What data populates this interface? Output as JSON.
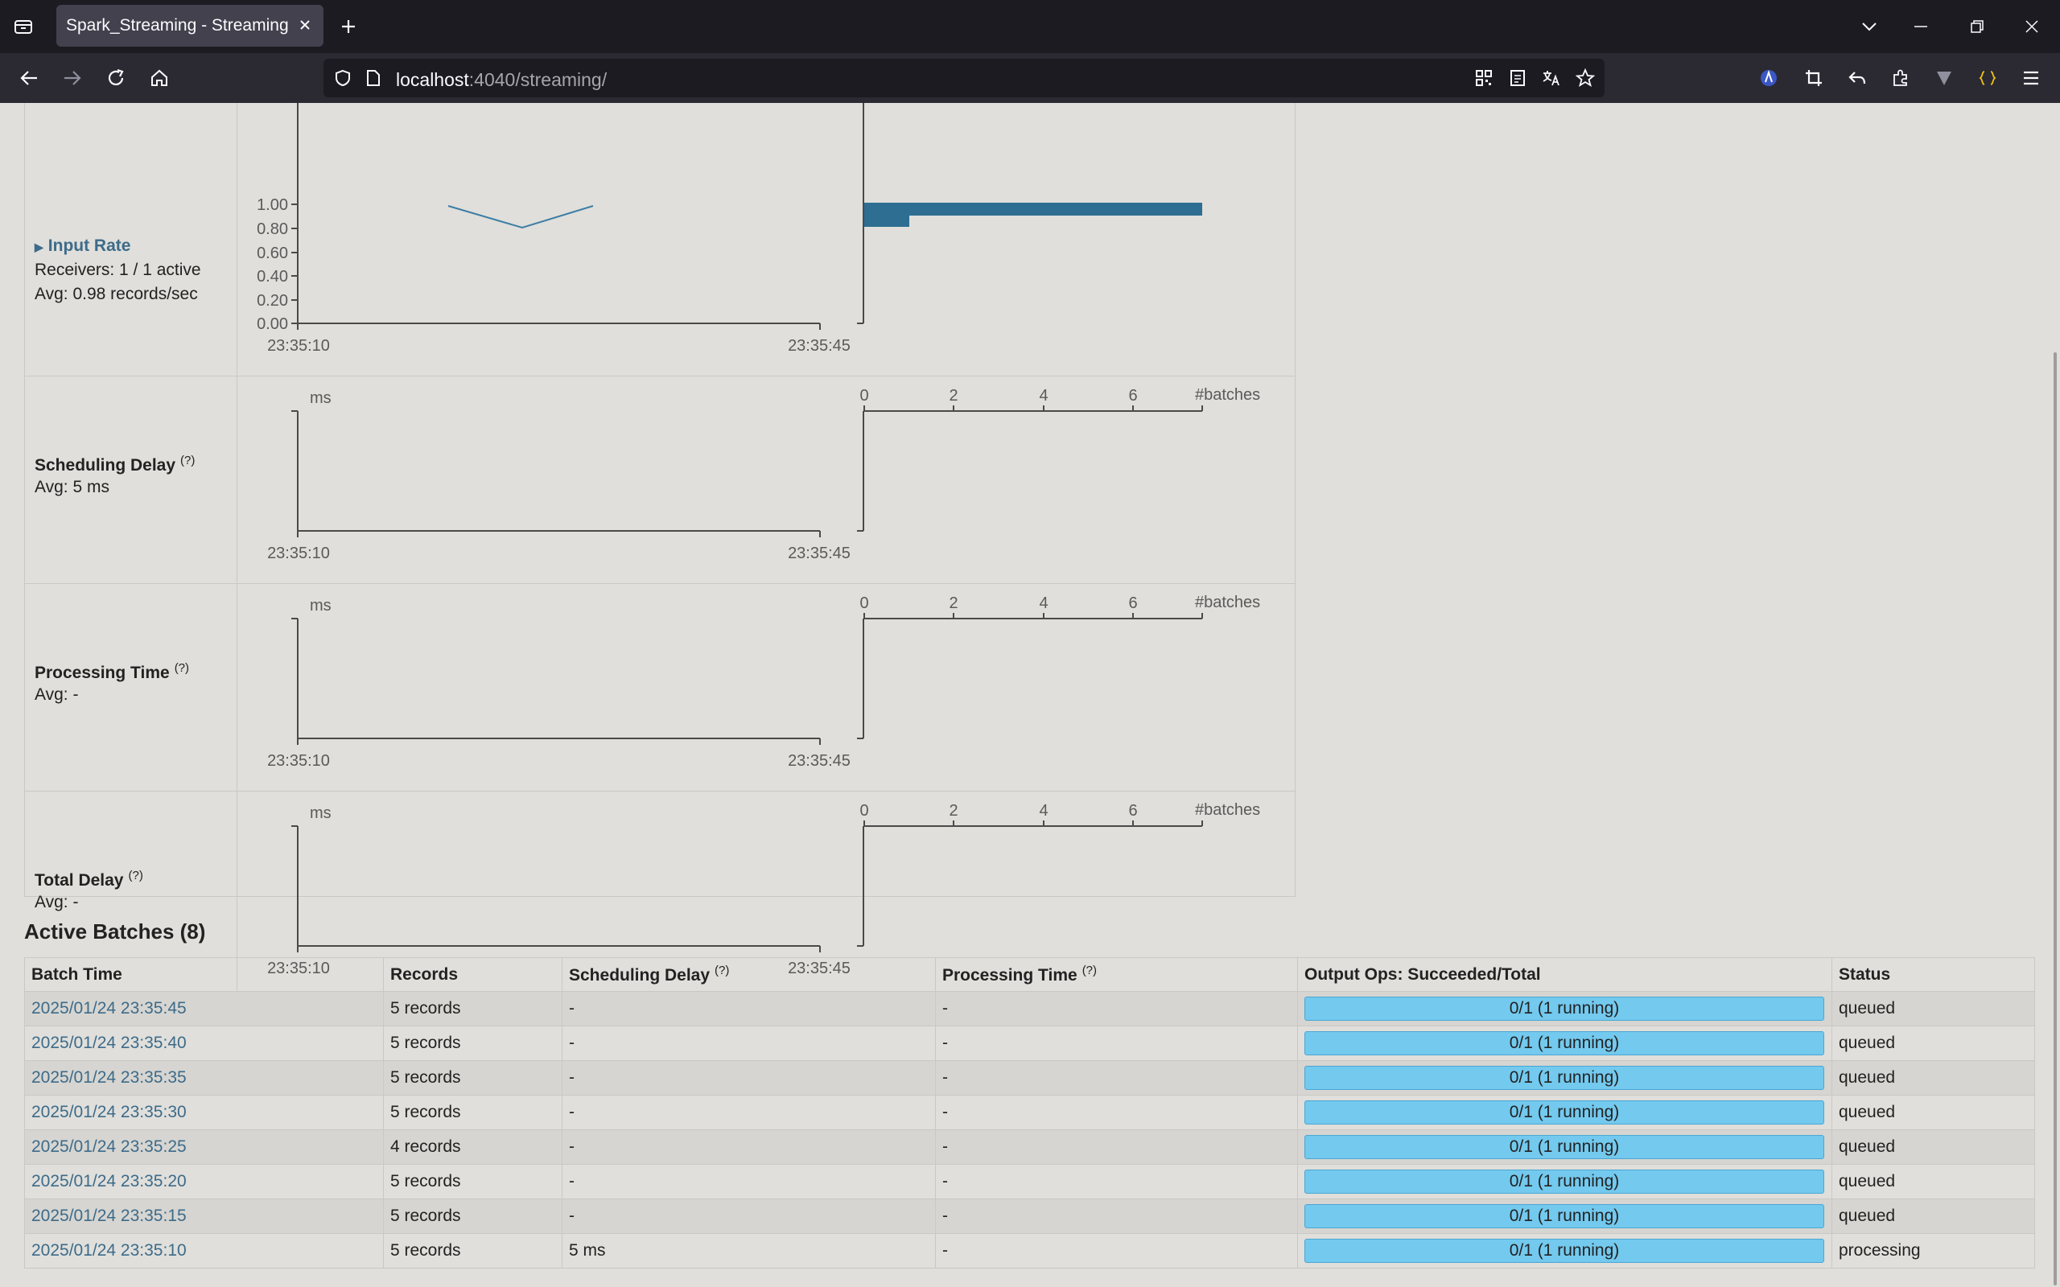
{
  "browser": {
    "tab_title": "Spark_Streaming - Streaming Statistics",
    "url_host": "localhost",
    "url_rest": ":4040/streaming/"
  },
  "charts": {
    "x_ticks": [
      "23:35:10",
      "23:35:45"
    ],
    "batches_ticks": [
      "0",
      "2",
      "4",
      "6"
    ],
    "unit_ms": "ms",
    "unit_batches": "#batches",
    "input_rate_yticks": [
      "1.00",
      "0.80",
      "0.60",
      "0.40",
      "0.20",
      "0.00"
    ]
  },
  "metrics": {
    "input_rate": {
      "title": "Input Rate",
      "line1": "Receivers: 1 / 1 active",
      "line2": "Avg: 0.98 records/sec"
    },
    "scheduling_delay": {
      "title": "Scheduling Delay",
      "help": "(?)",
      "avg": "Avg: 5 ms"
    },
    "processing_time": {
      "title": "Processing Time",
      "help": "(?)",
      "avg": "Avg: -"
    },
    "total_delay": {
      "title": "Total Delay",
      "help": "(?)",
      "avg": "Avg: -"
    }
  },
  "active_batches": {
    "heading": "Active Batches (8)",
    "headers": {
      "batch_time": "Batch Time",
      "records": "Records",
      "scheduling_delay": "Scheduling Delay",
      "processing_time": "Processing Time",
      "help": "(?)",
      "output_ops": "Output Ops: Succeeded/Total",
      "status": "Status"
    },
    "rows": [
      {
        "batch_time": "2025/01/24 23:35:45",
        "records": "5 records",
        "scheduling_delay": "-",
        "processing_time": "-",
        "output_ops": "0/1 (1 running)",
        "status": "queued"
      },
      {
        "batch_time": "2025/01/24 23:35:40",
        "records": "5 records",
        "scheduling_delay": "-",
        "processing_time": "-",
        "output_ops": "0/1 (1 running)",
        "status": "queued"
      },
      {
        "batch_time": "2025/01/24 23:35:35",
        "records": "5 records",
        "scheduling_delay": "-",
        "processing_time": "-",
        "output_ops": "0/1 (1 running)",
        "status": "queued"
      },
      {
        "batch_time": "2025/01/24 23:35:30",
        "records": "5 records",
        "scheduling_delay": "-",
        "processing_time": "-",
        "output_ops": "0/1 (1 running)",
        "status": "queued"
      },
      {
        "batch_time": "2025/01/24 23:35:25",
        "records": "4 records",
        "scheduling_delay": "-",
        "processing_time": "-",
        "output_ops": "0/1 (1 running)",
        "status": "queued"
      },
      {
        "batch_time": "2025/01/24 23:35:20",
        "records": "5 records",
        "scheduling_delay": "-",
        "processing_time": "-",
        "output_ops": "0/1 (1 running)",
        "status": "queued"
      },
      {
        "batch_time": "2025/01/24 23:35:15",
        "records": "5 records",
        "scheduling_delay": "-",
        "processing_time": "-",
        "output_ops": "0/1 (1 running)",
        "status": "queued"
      },
      {
        "batch_time": "2025/01/24 23:35:10",
        "records": "5 records",
        "scheduling_delay": "5 ms",
        "processing_time": "-",
        "output_ops": "0/1 (1 running)",
        "status": "processing"
      }
    ]
  },
  "colors": {
    "link": "#3d6b8a",
    "progress_fill": "#73c9ee",
    "chart_line": "#3d7ea6"
  },
  "icons": [
    "tab-list-icon",
    "close-icon",
    "plus-icon",
    "chevron-down-icon",
    "minimize-icon",
    "restore-icon",
    "window-close-icon",
    "back-arrow-icon",
    "forward-arrow-icon",
    "reload-icon",
    "home-icon",
    "shield-icon",
    "page-icon",
    "qr-code-icon",
    "reader-view-icon",
    "translate-icon",
    "star-icon",
    "extension-icon",
    "crop-icon",
    "undo-icon",
    "puzzle-icon",
    "v-extension-icon",
    "json-icon",
    "menu-icon"
  ]
}
